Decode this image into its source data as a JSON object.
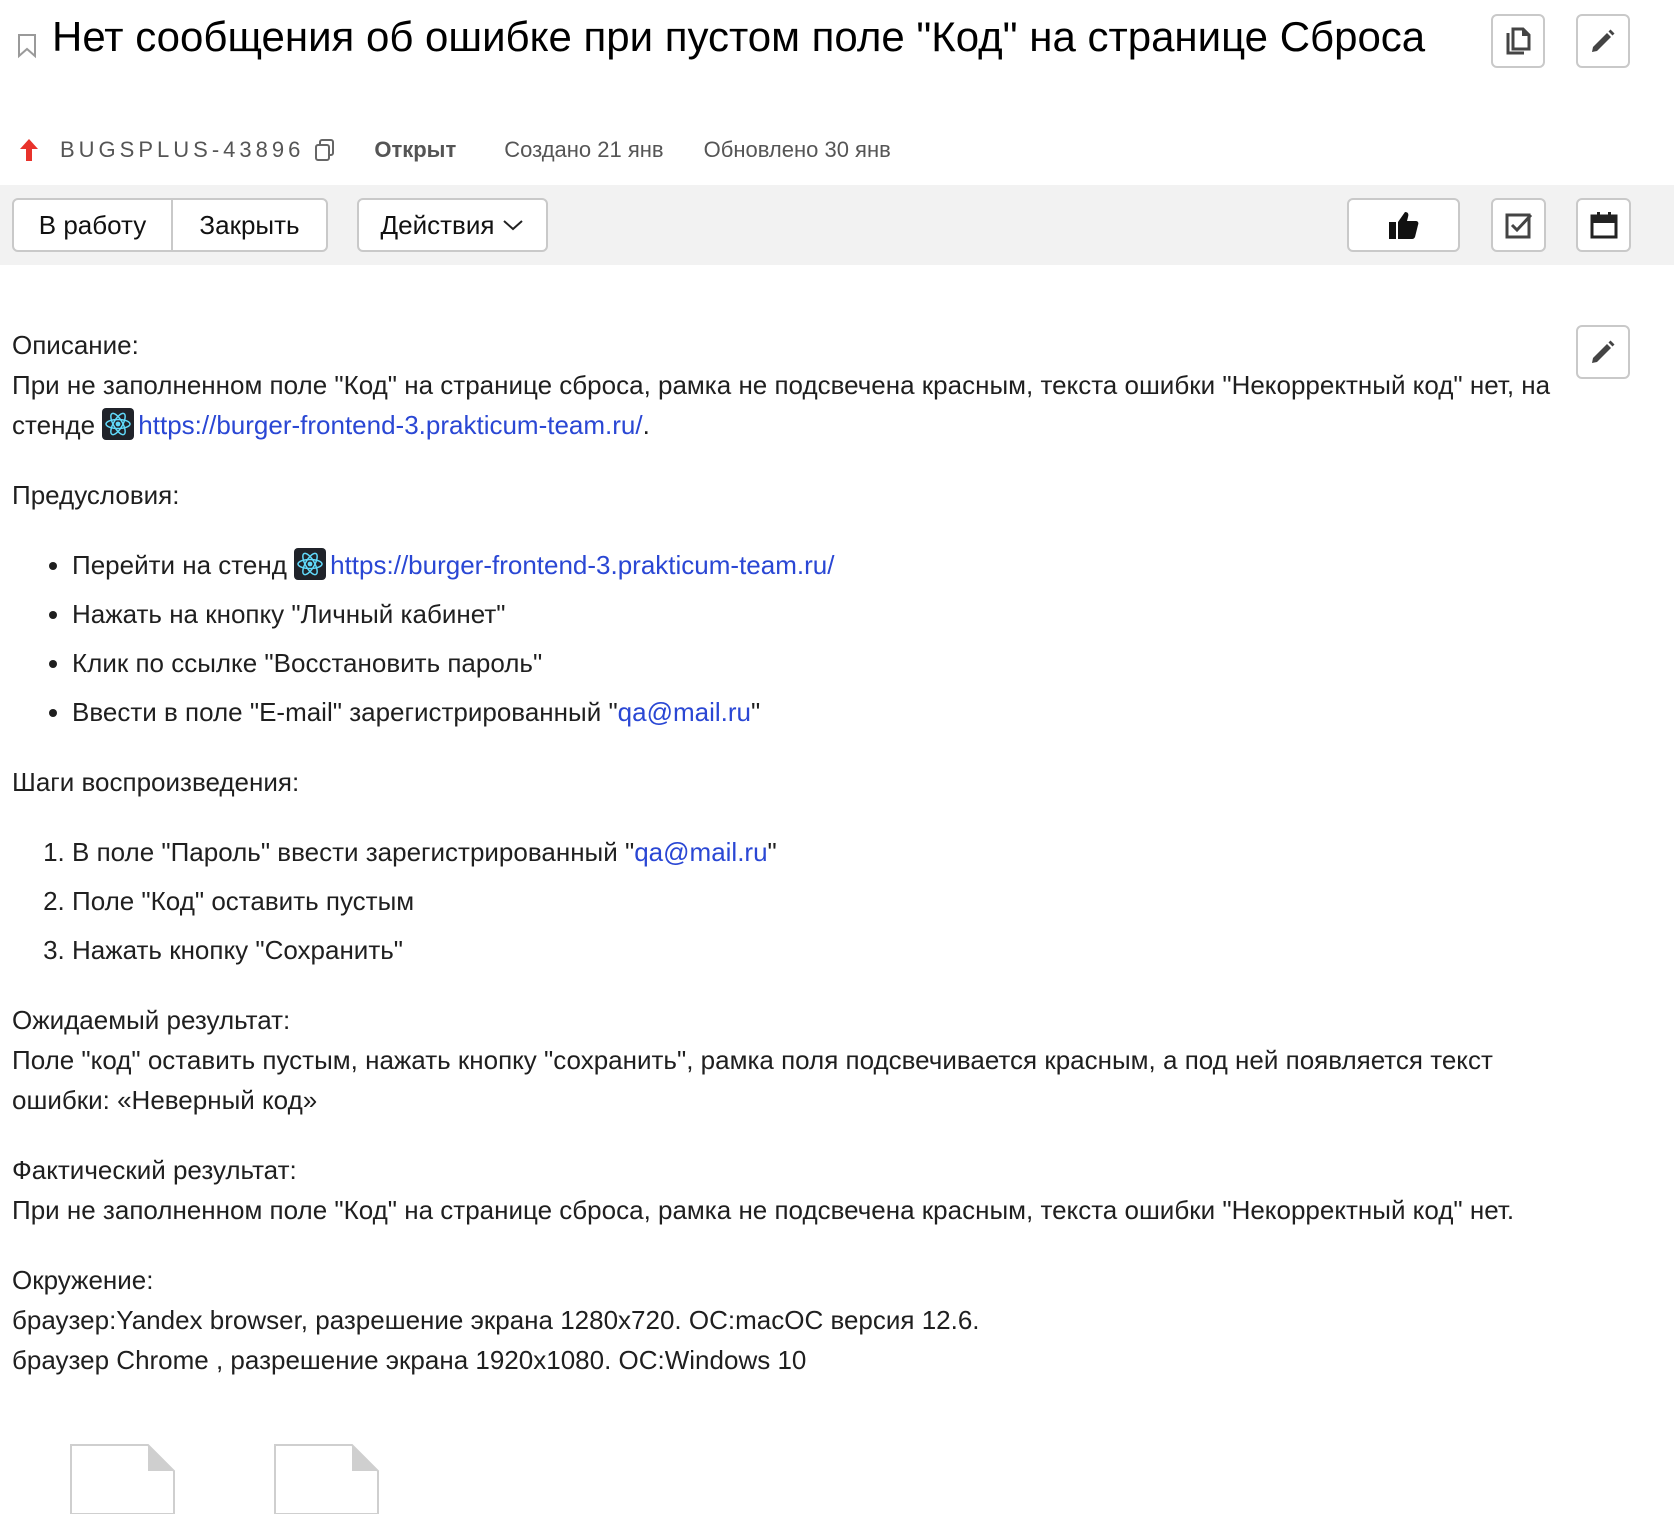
{
  "issue": {
    "title": "Нет сообщения об ошибке при пустом поле \"Код\" на странице Сброса",
    "key": "BUGSPLUS-43896",
    "status": "Открыт",
    "created": "Создано 21 янв",
    "updated": "Обновлено 30 янв"
  },
  "toolbar": {
    "start_label": "В работу",
    "close_label": "Закрыть",
    "actions_label": "Действия"
  },
  "description": {
    "heading": "Описание:",
    "text_before": "При не заполненном поле \"Код\" на странице сброса, рамка не подсвечена красным, текста ошибки \"Некорректный код\" нет, на стенде ",
    "link": "https://burger-frontend-3.prakticum-team.ru/",
    "text_after": "."
  },
  "preconditions": {
    "heading": "Предусловия:",
    "item1_text": "Перейти на стенд ",
    "item1_link": "https://burger-frontend-3.prakticum-team.ru/",
    "item2": "Нажать на кнопку \"Личный кабинет\"",
    "item3": "Клик по ссылке \"Восстановить пароль\"",
    "item4_before": "Ввести в поле \"E-mail\" зарегистрированный \"",
    "item4_link": "qa@mail.ru",
    "item4_after": "\""
  },
  "steps": {
    "heading": "Шаги воспроизведения:",
    "step1_before": "В поле \"Пароль\" ввести зарегистрированный \"",
    "step1_link": "qa@mail.ru",
    "step1_after": "\"",
    "step2": "Поле \"Код\" оставить пустым",
    "step3": "Нажать кнопку \"Сохранить\""
  },
  "expected": {
    "heading": "Ожидаемый результат:",
    "text": "Поле \"код\" оставить пустым, нажать кнопку \"сохранить\", рамка поля подсвечивается красным, а под ней появляется текст ошибки: «Неверный код»"
  },
  "actual": {
    "heading": "Фактический результат:",
    "text": "При не заполненном поле \"Код\" на странице сброса, рамка не подсвечена красным, текста ошибки \"Некорректный код\" нет."
  },
  "environment": {
    "heading": "Окружение:",
    "line1": "браузер:Yandex browser, разрешение экрана 1280x720. ОС:macOC версия 12.6.",
    "line2": "браузер Chrome , разрешение экрана 1920x1080. ОС:Windows 10"
  },
  "colors": {
    "link": "#2a47d4",
    "priority_arrow": "#e8322b",
    "toolbar_bg": "#f2f2f2",
    "button_border": "#c9c9c9"
  },
  "icons": [
    "bookmark-icon",
    "priority-up-icon",
    "copy-key-icon",
    "clone-icon",
    "edit-icon",
    "chevron-down-icon",
    "thumbs-up-icon",
    "checkbox-icon",
    "calendar-icon",
    "react-icon",
    "file-icon"
  ]
}
